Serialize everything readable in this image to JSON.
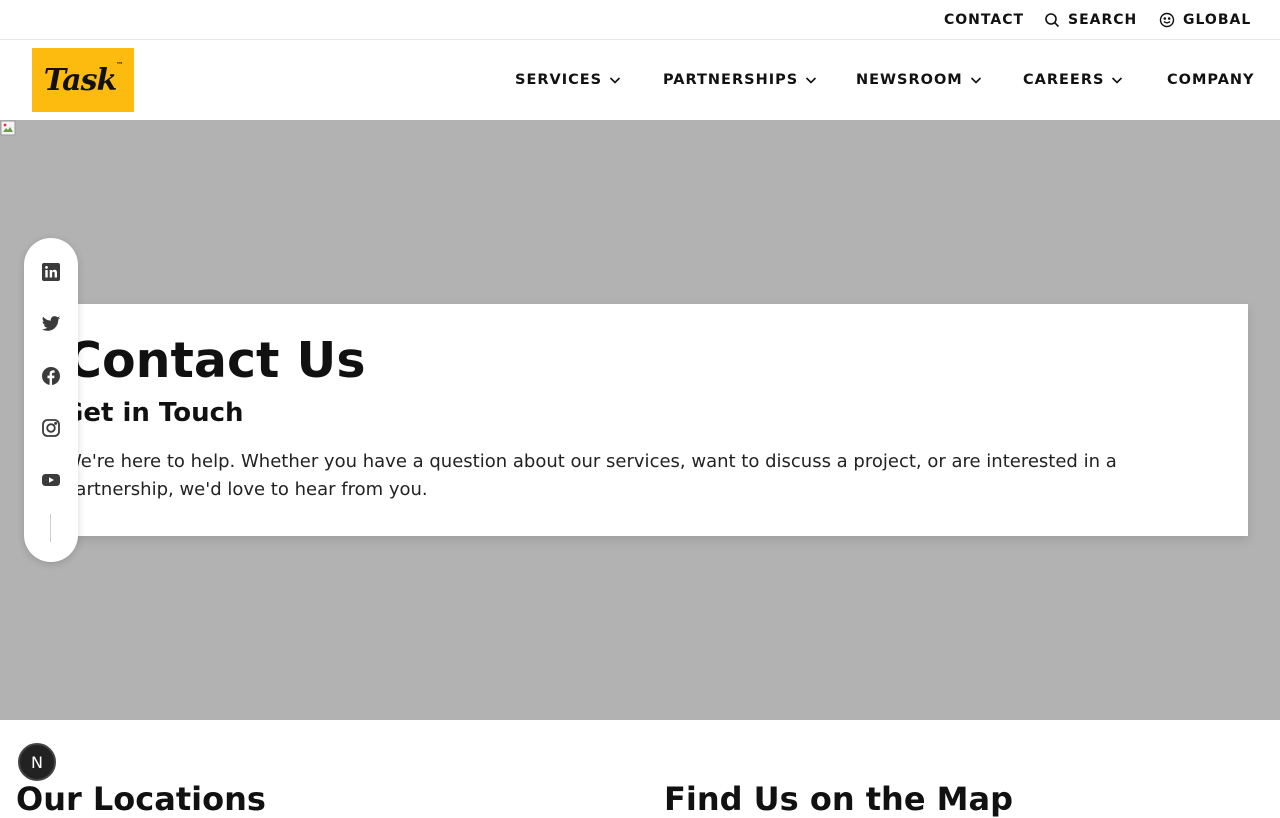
{
  "utility_nav": {
    "contact": "CONTACT",
    "search": "SEARCH",
    "global": "GLOBAL"
  },
  "logo": {
    "text": "Task",
    "mark": "™",
    "bg_color": "#fdbb10"
  },
  "main_nav": {
    "items": [
      {
        "label": "SERVICES",
        "dropdown": true
      },
      {
        "label": "PARTNERSHIPS",
        "dropdown": true
      },
      {
        "label": "NEWSROOM",
        "dropdown": true
      },
      {
        "label": "CAREERS",
        "dropdown": true
      },
      {
        "label": "COMPANY",
        "dropdown": false
      }
    ]
  },
  "hero": {
    "bg_color": "#b2b2b2",
    "title": "Contact Us",
    "subtitle": "Get in Touch",
    "body": "We're here to help. Whether you have a question about our services, want to discuss a project, or are interested in a partnership, we'd love to hear from you."
  },
  "social": {
    "icons": [
      "linkedin-icon",
      "twitter-icon",
      "facebook-icon",
      "instagram-icon",
      "youtube-icon"
    ]
  },
  "sections": {
    "locations_heading": "Our Locations",
    "map_heading": "Find Us on the Map"
  },
  "badge": {
    "letter": "N"
  }
}
